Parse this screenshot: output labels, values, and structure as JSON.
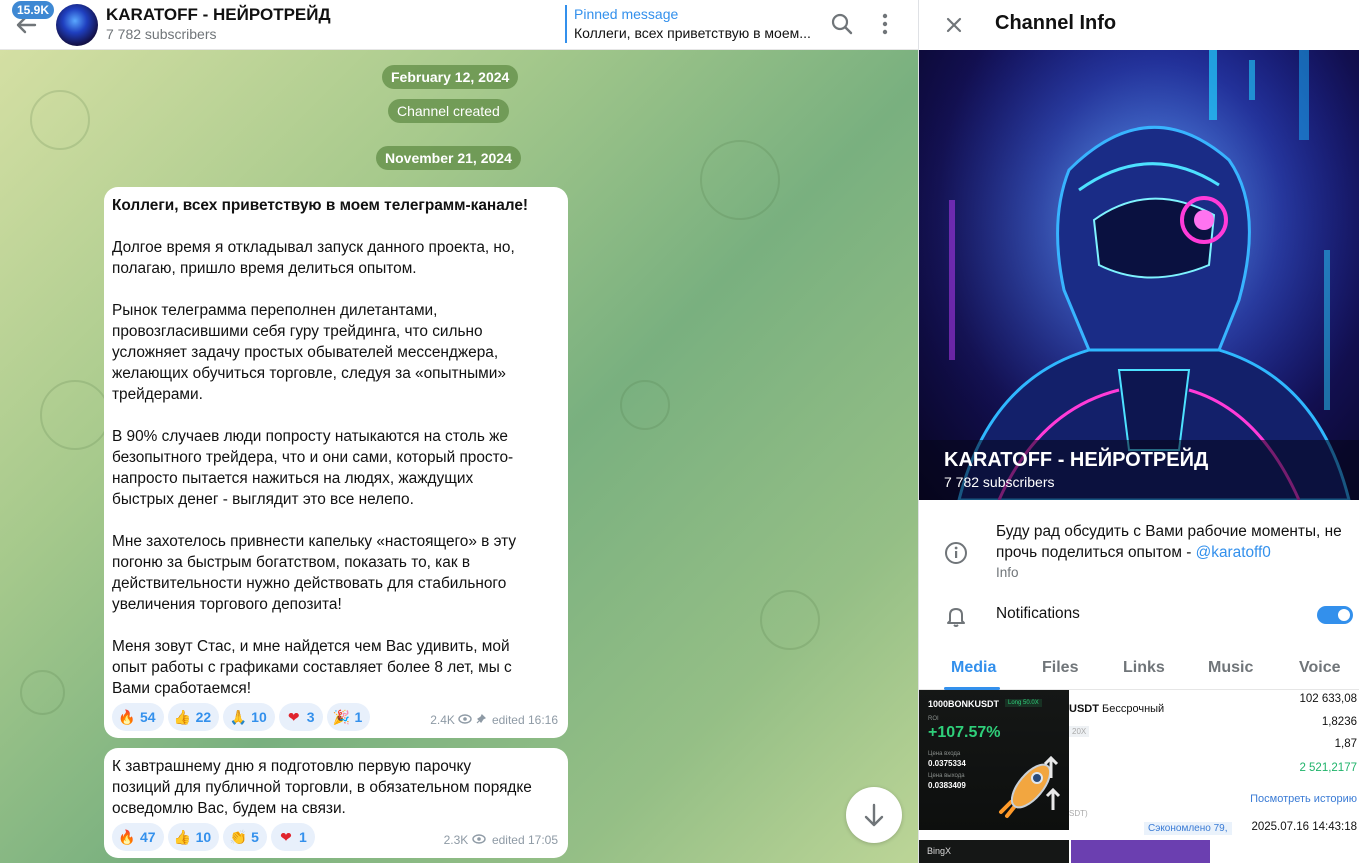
{
  "header": {
    "unread_badge": "15.9K",
    "title": "KARATOFF - НЕЙРОТРЕЙД",
    "subtitle": "7 782 subscribers",
    "pinned_title": "Pinned message",
    "pinned_text": "Коллеги, всех приветствую в моем..."
  },
  "chat": {
    "date1": "February 12, 2024",
    "service1": "Channel created",
    "date2": "November 21, 2024",
    "messages": [
      {
        "title": "Коллеги, всех приветствую в моем телеграмм-канале!",
        "p1": "Долгое время я откладывал запуск данного проекта, но,\nполагаю, пришло время делиться опытом.",
        "p2": "Рынок телеграмма переполнен дилетантами,\nпровозгласившими себя гуру трейдинга, что сильно\nусложняет задачу простых обывателей мессенджера,\nжелающих обучиться торговле, следуя за «опытными»\nтрейдерами.",
        "p3": "В 90% случаев люди попросту натыкаются на столь же\nбезопытного трейдера, что и они сами, который просто-\nнапросто пытается нажиться на людях, жаждущих\nбыстрых денег - выглядит это все нелепо.",
        "p4": "Мне захотелось привнести капельку «настоящего» в эту\nпогоню за быстрым богатством, показать то, как в\nдействительности нужно действовать для стабильного\nувеличения торгового депозита!",
        "p5": "Меня зовут Стас, и мне найдется чем Вас удивить, мой\nопыт работы с графиками составляет более 8 лет, мы с\nВами сработаемся!",
        "reactions": [
          {
            "emoji": "🔥",
            "count": "54"
          },
          {
            "emoji": "👍",
            "count": "22"
          },
          {
            "emoji": "🙏",
            "count": "10"
          },
          {
            "emoji": "❤",
            "count": "3"
          },
          {
            "emoji": "🎉",
            "count": "1"
          }
        ],
        "views": "2.4K",
        "edited": "edited 16:16"
      },
      {
        "text": "К завтрашнему дню я подготовлю первую парочку\nпозиций для публичной торговли, в обязательном порядке\nосведомлю Вас, будем на связи.",
        "reactions": [
          {
            "emoji": "🔥",
            "count": "47"
          },
          {
            "emoji": "👍",
            "count": "10"
          },
          {
            "emoji": "👏",
            "count": "5"
          },
          {
            "emoji": "❤",
            "count": "1"
          }
        ],
        "views": "2.3K",
        "edited": "edited 17:05"
      }
    ]
  },
  "info": {
    "title": "Channel Info",
    "cover_name": "KARATOFF - НЕЙРОТРЕЙД",
    "cover_sub": "7 782 subscribers",
    "about_text": "Буду рад обсудить с Вами рабочие моменты, не прочь поделиться опытом - ",
    "about_link": "@karatoff0",
    "about_label": "Info",
    "notifications_label": "Notifications",
    "notifications_on": true,
    "tabs": [
      "Media",
      "Files",
      "Links",
      "Music",
      "Voice"
    ],
    "active_tab": "Media",
    "media": {
      "tile1": {
        "pair": "1000BONKUSDT",
        "tag": "Long 50.0X",
        "roi_label": "ROI",
        "roi": "+107.57%",
        "entry_label": "Цена входа",
        "entry": "0.0375334",
        "exit_label": "Цена выхода",
        "exit": "0.0383409",
        "bottom_label": "BingX"
      },
      "tile2": {
        "title_bold": "USDT",
        "title_rest": " Бессрочный",
        "v1": "102 633,08",
        "v2": "1,8236",
        "lev": "20X",
        "v3": "1,87",
        "v4": "2 521,2177",
        "history": "Посмотреть историю",
        "dot": "SDT)",
        "saved": "Сэкономлено 79,",
        "date": "2025.07.16 14:43:18"
      }
    }
  },
  "colors": {
    "accent": "#3390ec",
    "pill": "#608c46",
    "profit": "#2fcf7a"
  }
}
